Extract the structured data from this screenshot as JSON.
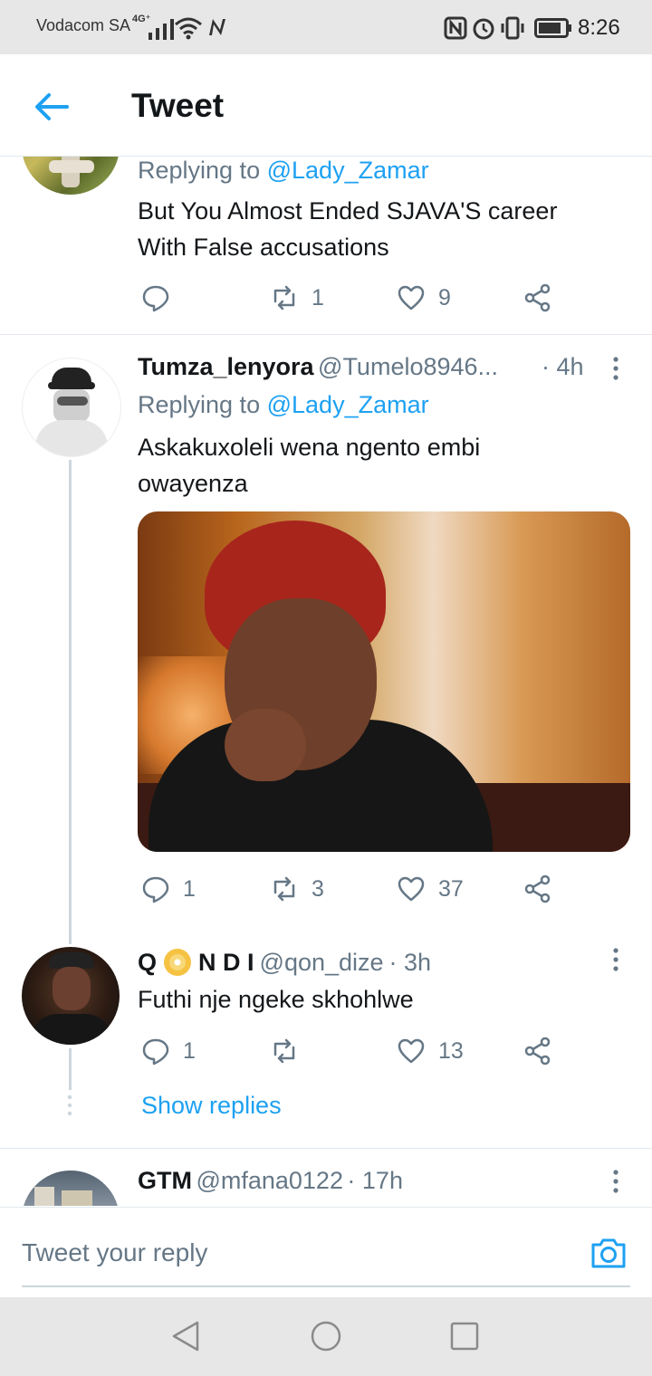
{
  "status_bar": {
    "carrier": "Vodacom SA",
    "network": "4G⁺",
    "time": "8:26"
  },
  "header": {
    "title": "Tweet",
    "back_icon": "arrow-left-icon"
  },
  "tweets": [
    {
      "replying_label": "Replying to",
      "replying_to": "@Lady_Zamar",
      "text_line1": "But You Almost Ended SJAVA'S career",
      "text_line2": "With False accusations",
      "reply_count": "",
      "retweet_count": "1",
      "like_count": "9"
    },
    {
      "name": "Tumza_lenyora",
      "handle": "@Tumelo8946...",
      "time": "· 4h",
      "replying_label": "Replying to",
      "replying_to": "@Lady_Zamar",
      "text_line1": "Askakuxoleli wena ngento embi",
      "text_line2": "owayenza",
      "reply_count": "1",
      "retweet_count": "3",
      "like_count": "37"
    },
    {
      "name_q": "Q",
      "name_rest": "N D I",
      "handle": "@qon_dize",
      "time": "· 3h",
      "text": "Futhi nje ngeke skhohlwe",
      "reply_count": "1",
      "retweet_count": "",
      "like_count": "13",
      "show_replies": "Show replies"
    },
    {
      "name": "GTM",
      "handle": "@mfana0122",
      "time": "· 17h"
    }
  ],
  "reply_bar": {
    "placeholder": "Tweet your reply"
  },
  "colors": {
    "accent": "#1da1f2",
    "muted": "#657786",
    "text": "#14171a"
  }
}
